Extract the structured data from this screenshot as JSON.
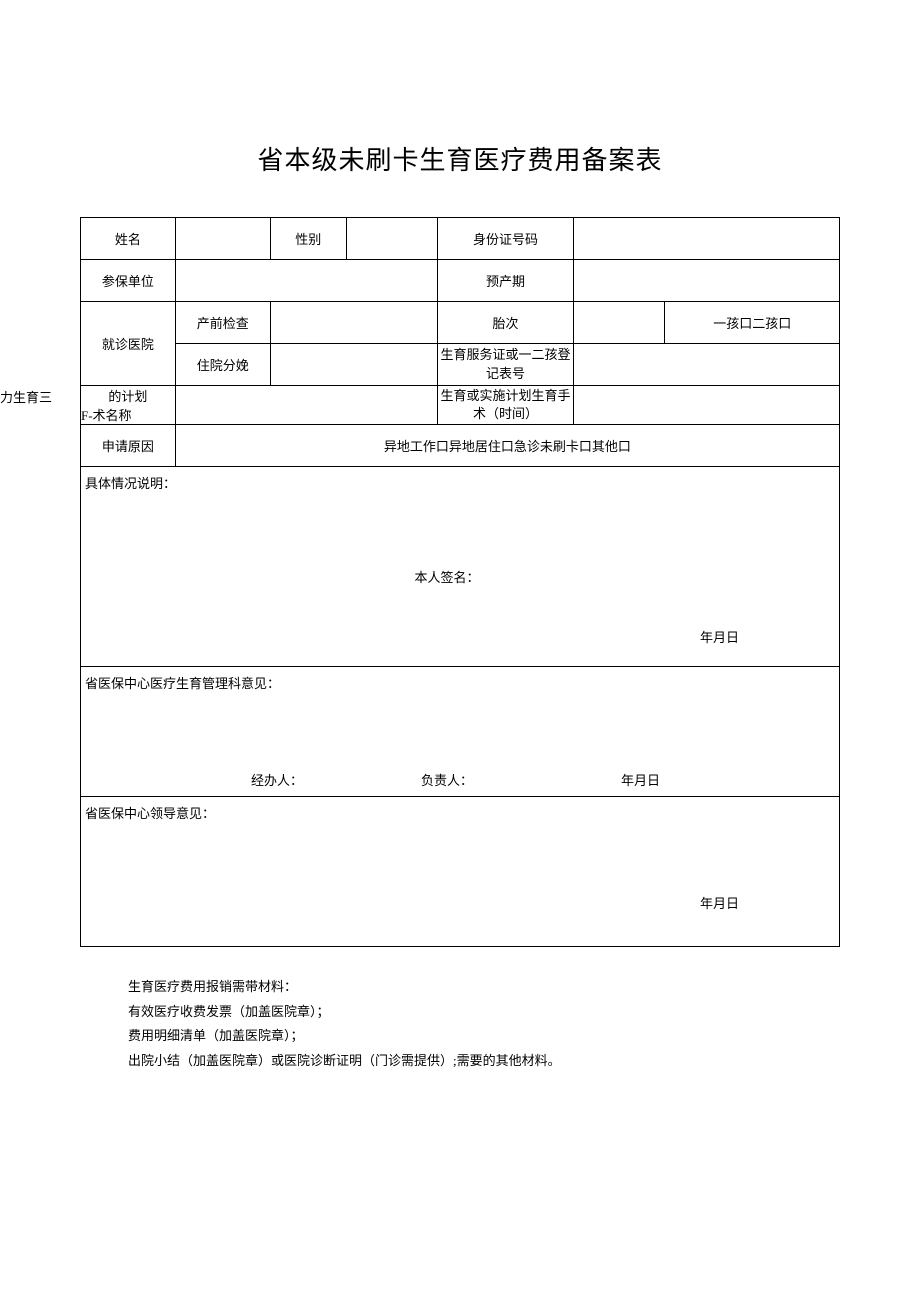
{
  "title": "省本级未刷卡生育医疗费用备案表",
  "labels": {
    "name": "姓名",
    "gender": "性别",
    "id_number": "身份证号码",
    "insured_unit": "参保单位",
    "expected_date": "预产期",
    "hospital": "就诊医院",
    "prenatal": "产前检查",
    "birth_order": "胎次",
    "birth_order_options": "一孩口二孩口",
    "inpatient": "住院分娩",
    "birth_cert": "生育服务证或一二孩登记表号",
    "shili_prefix": "实力生育三",
    "plan_label": "的计划",
    "f_operation": "F-术名称",
    "birth_time": "生育或实施计划生育手术（时间）",
    "apply_reason": "申请原因",
    "reason_options": "异地工作口异地居住口急诊未刷卡口其他口",
    "detail_desc": "具体情况说明：",
    "self_sign": "本人签名：",
    "date_ymd": "年月日",
    "opinion1_label": "省医保中心医疗生育管理科意见：",
    "jingban": "经办人：",
    "fuze": "负责人：",
    "opinion2_label": "省医保中心领导意见："
  },
  "footer": {
    "line1": "生育医疗费用报销需带材料：",
    "line2": "有效医疗收费发票（加盖医院章）；",
    "line3": "费用明细清单（加盖医院章）；",
    "line4": "出院小结（加盖医院章）或医院诊断证明（门诊需提供）;需要的其他材料。"
  },
  "values": {
    "name": "",
    "gender": "",
    "id_number": "",
    "insured_unit": "",
    "expected_date": "",
    "prenatal_hospital": "",
    "birth_order": "",
    "inpatient_hospital": "",
    "birth_cert_no": "",
    "operation": "",
    "birth_time": ""
  }
}
